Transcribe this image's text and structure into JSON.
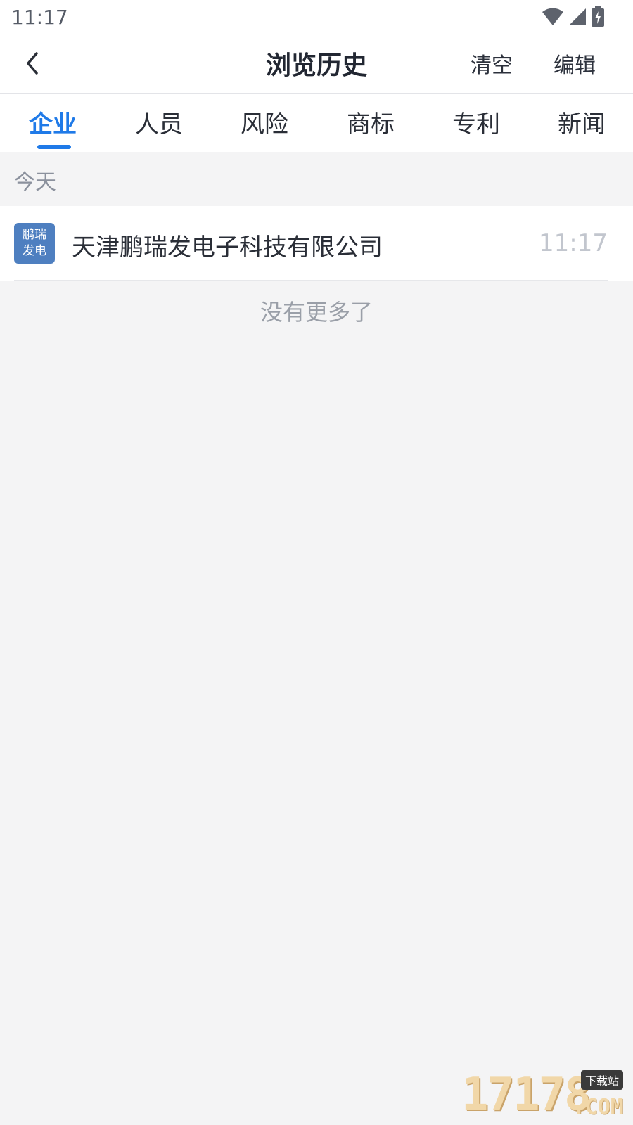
{
  "status_bar": {
    "time": "11:17",
    "icons": [
      "wifi-icon",
      "signal-icon",
      "battery-charging-icon"
    ]
  },
  "nav": {
    "title": "浏览历史",
    "clear_label": "清空",
    "edit_label": "编辑",
    "back_icon": "chevron-left-icon"
  },
  "tabs": [
    {
      "label": "企业",
      "active": true
    },
    {
      "label": "人员",
      "active": false
    },
    {
      "label": "风险",
      "active": false
    },
    {
      "label": "商标",
      "active": false
    },
    {
      "label": "专利",
      "active": false
    },
    {
      "label": "新闻",
      "active": false
    }
  ],
  "sections": [
    {
      "label": "今天",
      "items": [
        {
          "logo_line1": "鹏瑞",
          "logo_line2": "发电",
          "name": "天津鹏瑞发电子科技有限公司",
          "time": "11:17"
        }
      ]
    }
  ],
  "footer": {
    "no_more": "没有更多了"
  },
  "watermark": {
    "digits": "17178",
    "badge": "下载站",
    "com": ".COM"
  },
  "colors": {
    "accent": "#1f7ae8",
    "logo_bg": "#4e7fc0",
    "page_bg": "#f4f4f5"
  }
}
